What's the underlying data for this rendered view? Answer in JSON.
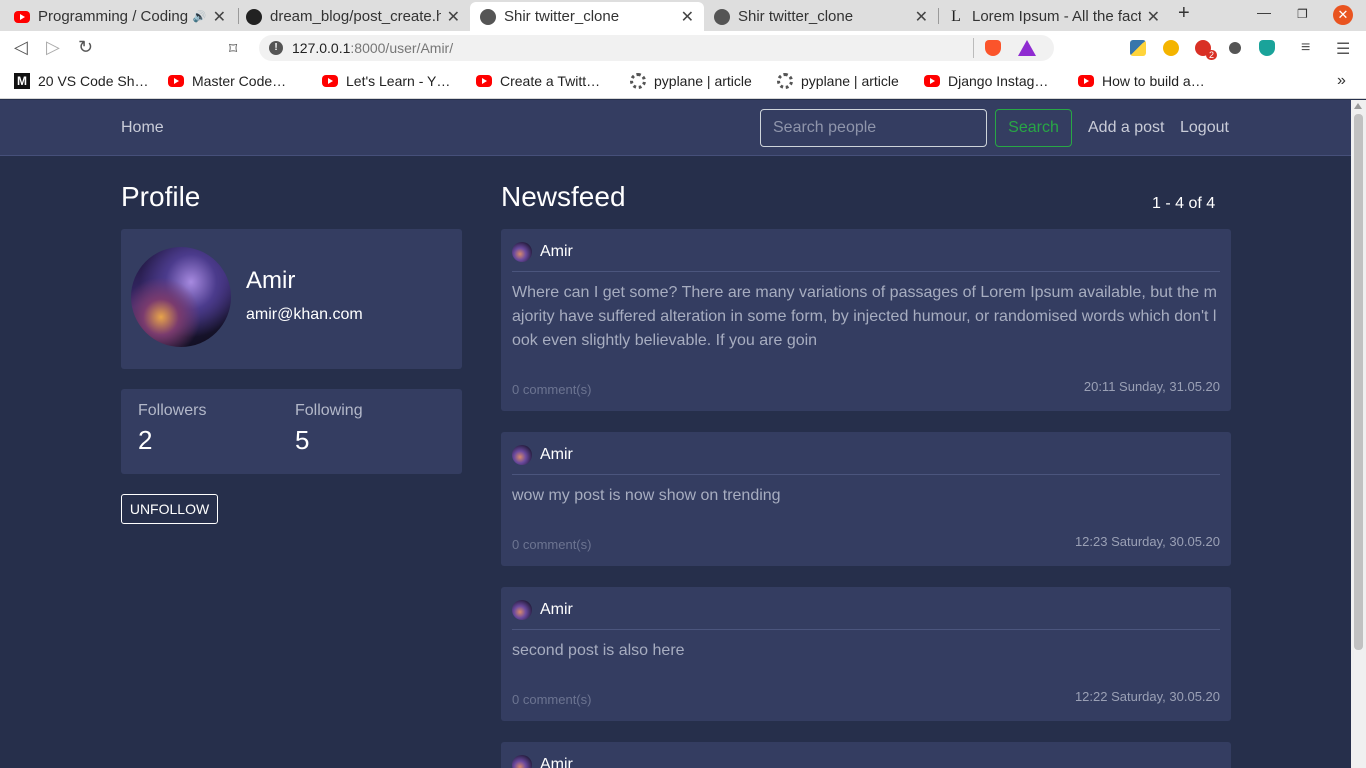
{
  "browser": {
    "tabs": [
      {
        "title": "Programming / Coding",
        "favicon": "youtube-icon",
        "active": false
      },
      {
        "title": "dream_blog/post_create.h",
        "favicon": "github-icon",
        "active": false
      },
      {
        "title": "Shir twitter_clone",
        "favicon": "globe-icon",
        "active": true
      },
      {
        "title": "Shir twitter_clone",
        "favicon": "globe-icon",
        "active": false
      },
      {
        "title": "Lorem Ipsum - All the facts",
        "favicon": "lipsum-icon",
        "active": false
      }
    ],
    "new_tab": "+",
    "url_host": "127.0.0.1",
    "url_rest": ":8000/user/Amir/",
    "bookmarks": [
      {
        "label": "20 VS Code Sh…",
        "favicon": "medium-icon"
      },
      {
        "label": "Master Code…",
        "favicon": "youtube-icon"
      },
      {
        "label": "Let's Learn - Y…",
        "favicon": "youtube-icon"
      },
      {
        "label": "Create a Twitt…",
        "favicon": "youtube-icon"
      },
      {
        "label": "pyplane | article",
        "favicon": "pyplane-icon"
      },
      {
        "label": "pyplane | article",
        "favicon": "pyplane-icon"
      },
      {
        "label": "Django Instag…",
        "favicon": "youtube-icon"
      },
      {
        "label": "How to build a…",
        "favicon": "youtube-icon"
      }
    ],
    "ext_badge": "2"
  },
  "navbar": {
    "home": "Home",
    "search_placeholder": "Search people",
    "search_button": "Search",
    "add_post": "Add a post",
    "logout": "Logout"
  },
  "profile": {
    "heading": "Profile",
    "name": "Amir",
    "email": "amir@khan.com",
    "followers_label": "Followers",
    "followers_count": "2",
    "following_label": "Following",
    "following_count": "5",
    "unfollow": "UNFOLLOW"
  },
  "newsfeed": {
    "heading": "Newsfeed",
    "pagination": "1 - 4 of 4",
    "posts": [
      {
        "author": "Amir",
        "body": "Where can I get some? There are many variations of passages of Lorem Ipsum available, but the majority have suffered alteration in some form, by injected humour, or randomised words which don't look even slightly believable. If you are goin",
        "comments": "0 comment(s)",
        "date": "20:11 Sunday, 31.05.20"
      },
      {
        "author": "Amir",
        "body": "wow my post is now show on trending",
        "comments": "0 comment(s)",
        "date": "12:23 Saturday, 30.05.20"
      },
      {
        "author": "Amir",
        "body": "second post is also here",
        "comments": "0 comment(s)",
        "date": "12:22 Saturday, 30.05.20"
      },
      {
        "author": "Amir"
      }
    ]
  },
  "colors": {
    "page_bg": "#262f4b",
    "card_bg": "#343d61",
    "search_green": "#28a745"
  }
}
